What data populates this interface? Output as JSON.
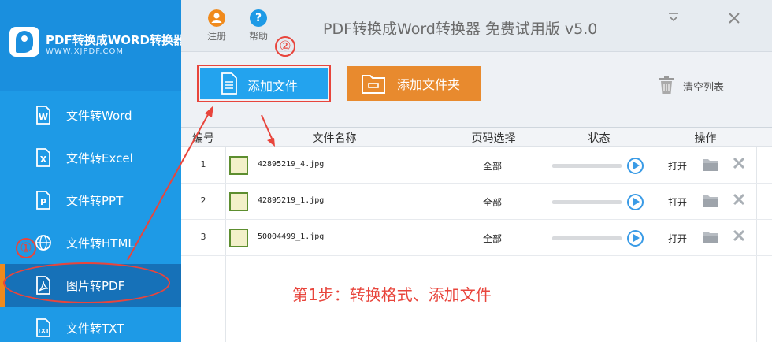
{
  "sidebar": {
    "brand_title": "PDF转换成WORD转换器",
    "brand_url": "WWW.XJPDF.COM",
    "items": [
      {
        "label": "文件转Word",
        "icon": "word-file-icon"
      },
      {
        "label": "文件转Excel",
        "icon": "excel-file-icon"
      },
      {
        "label": "文件转PPT",
        "icon": "ppt-file-icon"
      },
      {
        "label": "文件转HTML",
        "icon": "globe-icon"
      },
      {
        "label": "图片转PDF",
        "icon": "pdf-file-icon",
        "active": true
      },
      {
        "label": "文件转TXT",
        "icon": "txt-file-icon"
      }
    ]
  },
  "header": {
    "register_label": "注册",
    "help_label": "帮助",
    "help_glyph": "?",
    "app_title": "PDF转换成Word转换器 免费试用版 v5.0"
  },
  "toolbar": {
    "add_file_label": "添加文件",
    "add_folder_label": "添加文件夹",
    "clear_label": "清空列表"
  },
  "table": {
    "headers": [
      "编号",
      "文件名称",
      "页码选择",
      "状态",
      "操作"
    ],
    "rows": [
      {
        "num": "1",
        "file": "42895219_4.jpg",
        "pages": "全部",
        "progress": 0,
        "action": "打开"
      },
      {
        "num": "2",
        "file": "42895219_1.jpg",
        "pages": "全部",
        "progress": 0,
        "action": "打开"
      },
      {
        "num": "3",
        "file": "50004499_1.jpg",
        "pages": "全部",
        "progress": 0,
        "action": "打开"
      }
    ]
  },
  "annotations": {
    "step_text": "第1步：转换格式、添加文件",
    "badge_1": "①",
    "badge_2": "②",
    "color": "#e8453c"
  },
  "colors": {
    "sidebar": "#1e9ae6",
    "sidebar_active": "#1671b8",
    "accent_orange": "#e88a2e",
    "button_blue": "#23a3ee"
  }
}
